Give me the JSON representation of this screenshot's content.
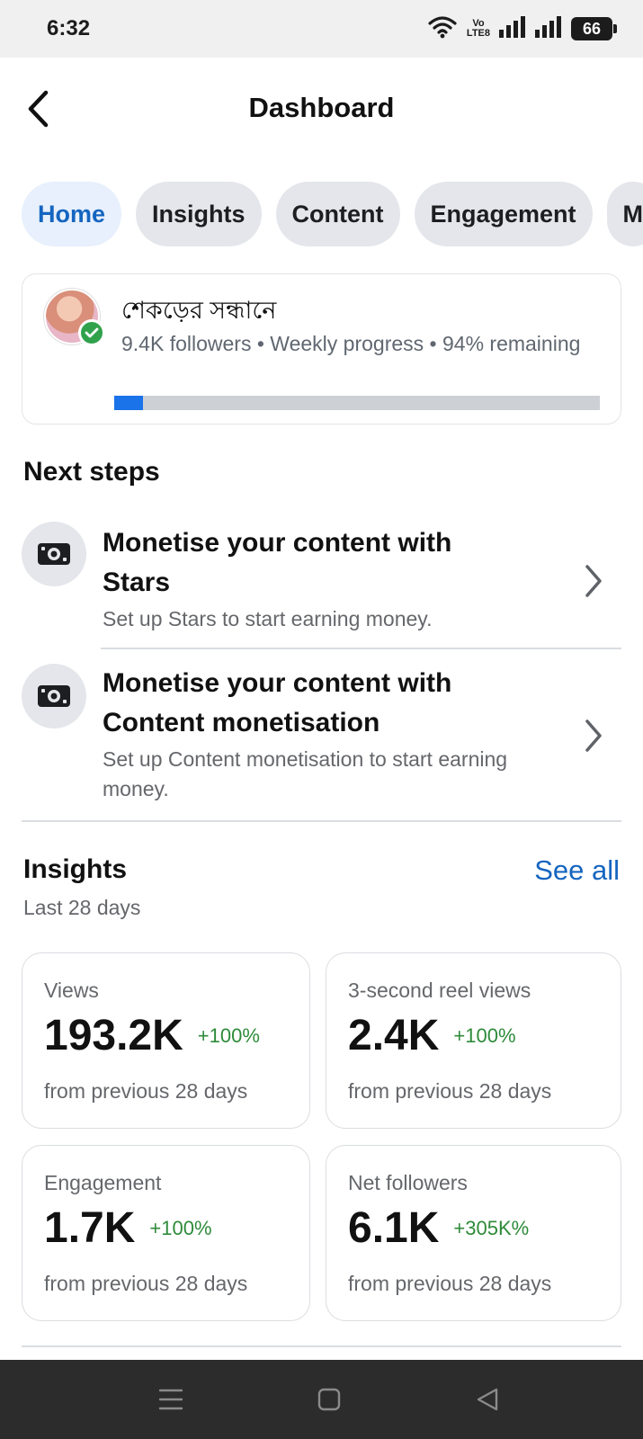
{
  "status_bar": {
    "time": "6:32",
    "volte_top": "Vo",
    "volte_bottom": "LTE8",
    "battery": "66"
  },
  "header": {
    "title": "Dashboard",
    "back_icon": "chevron-left-icon"
  },
  "tabs": [
    {
      "label": "Home",
      "active": true
    },
    {
      "label": "Insights",
      "active": false
    },
    {
      "label": "Content",
      "active": false
    },
    {
      "label": "Engagement",
      "active": false
    },
    {
      "label": "M",
      "active": false
    }
  ],
  "profile": {
    "name": "শেকড়ের সন্ধানে",
    "meta": "9.4K followers • Weekly progress • 94% remaining",
    "progress_fraction": 0.06,
    "verified_color": "#31a24c"
  },
  "next_steps": {
    "title": "Next steps",
    "items": [
      {
        "title": "Monetise your content with Stars",
        "description": "Set up Stars to start earning money.",
        "icon": "money-icon"
      },
      {
        "title": "Monetise your content with Content monetisation",
        "description": "Set up Content monetisation to start earning money.",
        "icon": "money-icon"
      }
    ]
  },
  "insights": {
    "title": "Insights",
    "see_all": "See all",
    "subtitle": "Last 28 days",
    "metrics": [
      {
        "label": "Views",
        "value": "193.2K",
        "change": "+100%",
        "footnote": "from previous 28 days"
      },
      {
        "label": "3-second reel views",
        "value": "2.4K",
        "change": "+100%",
        "footnote": "from previous 28 days"
      },
      {
        "label": "Engagement",
        "value": "1.7K",
        "change": "+100%",
        "footnote": "from previous 28 days"
      },
      {
        "label": "Net followers",
        "value": "6.1K",
        "change": "+305K%",
        "footnote": "from previous 28 days"
      }
    ]
  },
  "colors": {
    "accent": "#1565c0",
    "positive": "#2e8b3a",
    "progress": "#1a73e8"
  },
  "nav_bar": {
    "icons": [
      "menu-icon",
      "home-square-icon",
      "back-triangle-icon"
    ]
  }
}
